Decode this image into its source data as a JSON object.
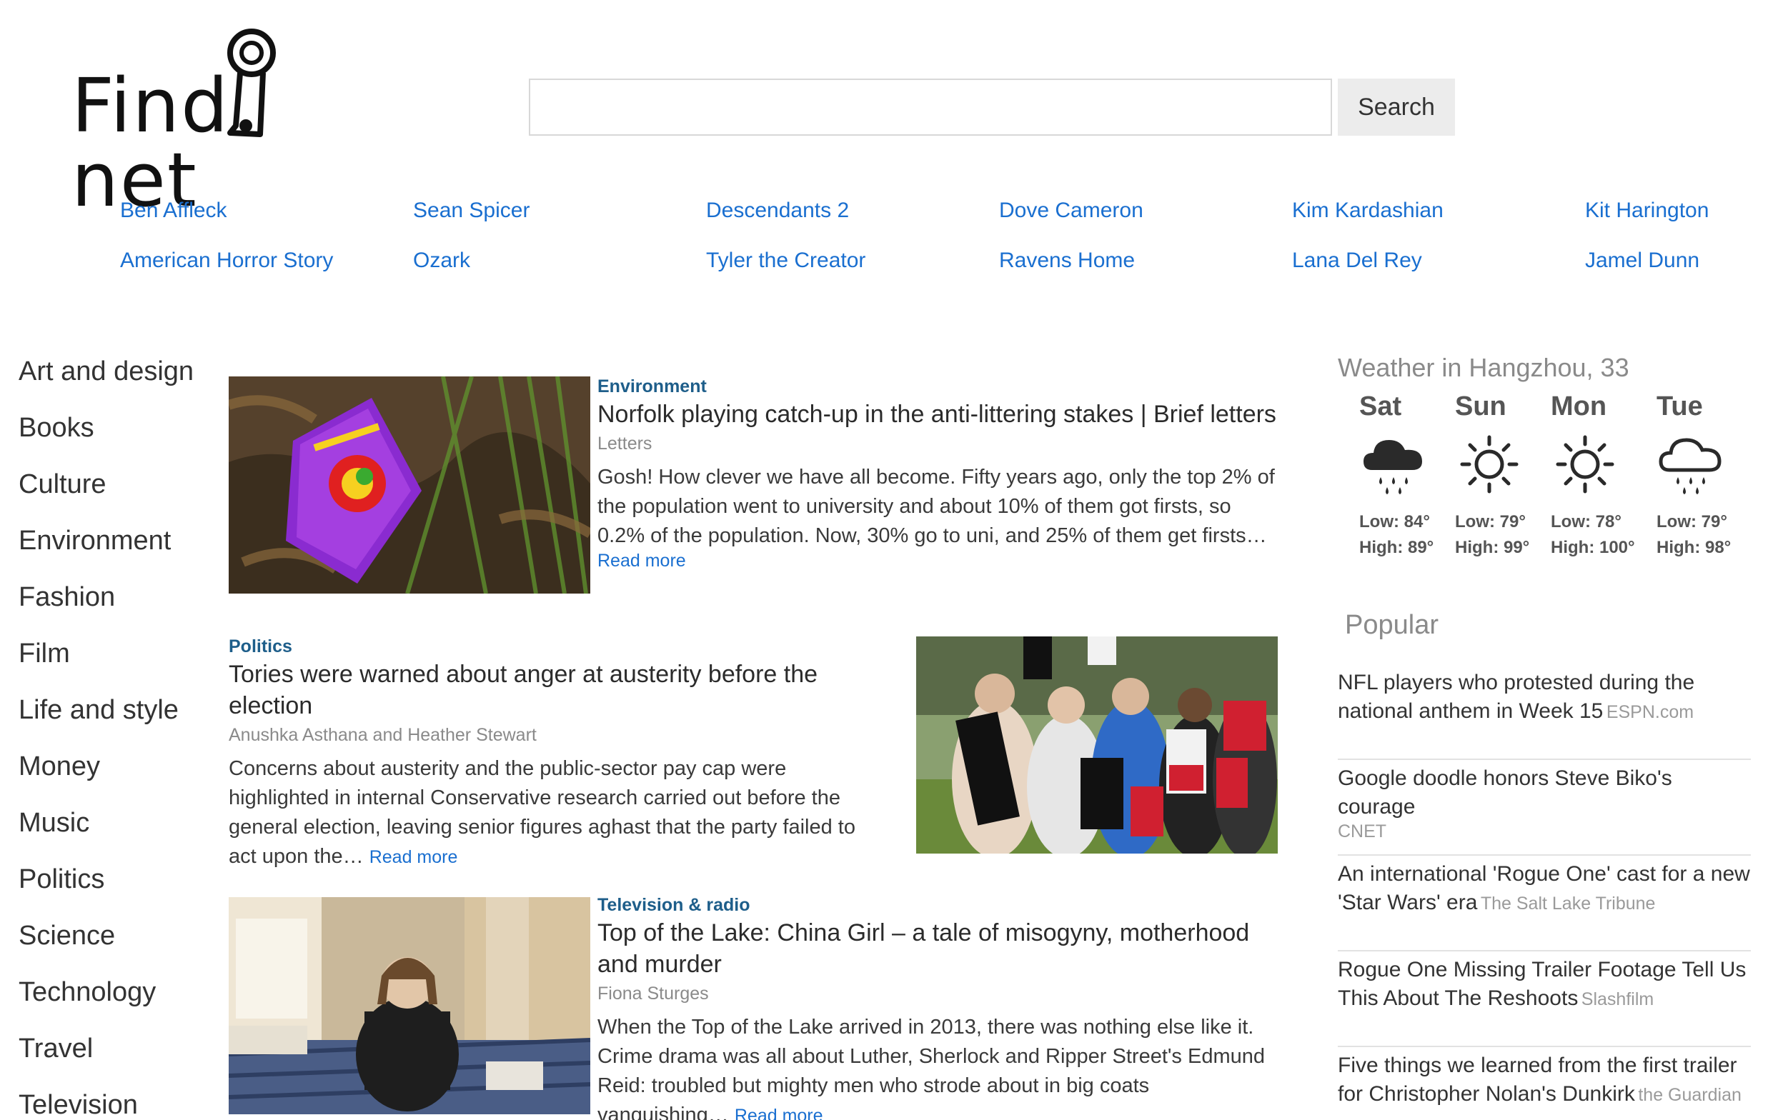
{
  "logo": {
    "text": "Find",
    "text2": "net"
  },
  "search": {
    "placeholder": "",
    "button_label": "Search"
  },
  "trends": [
    "Ben Affleck",
    "Sean Spicer",
    "Descendants 2",
    "Dove Cameron",
    "Kim Kardashian",
    "Kit Harington",
    "American Horror Story",
    "Ozark",
    "Tyler the Creator",
    "Ravens Home",
    "Lana Del Rey",
    "Jamel Dunn"
  ],
  "categories": [
    "Art and design",
    "Books",
    "Culture",
    "Environment",
    "Fashion",
    "Film",
    "Life and style",
    "Money",
    "Music",
    "Politics",
    "Science",
    "Technology",
    "Travel",
    "Television"
  ],
  "articles": [
    {
      "tag": "Environment",
      "title": "Norfolk playing catch-up in the anti-littering stakes | Brief letters",
      "author": "Letters",
      "text": "Gosh! How clever we have all become. Fifty years ago, only the top 2% of the population went to university and about 10% of them got firsts, so 0.2% of the population. Now, 30% go to uni, and 25% of them get firsts…",
      "read_more": "Read more"
    },
    {
      "tag": "Politics",
      "title": "Tories were warned about anger at austerity before the election",
      "author": "Anushka Asthana and Heather Stewart",
      "text": "Concerns about austerity and the public-sector pay cap were highlighted in internal Conservative research carried out before the general election, leaving senior figures aghast that the party failed to act upon the…",
      "read_more": "Read more"
    },
    {
      "tag": "Television & radio",
      "title": "Top of the Lake: China Girl – a tale of misogyny, motherhood and murder",
      "author": "Fiona Sturges",
      "text": "When the Top of the Lake arrived in 2013, there was nothing else like it. Crime drama was all about Luther, Sherlock and Ripper Street's Edmund Reid: troubled but mighty men who strode about in big coats vanquishing…",
      "read_more": "Read more"
    }
  ],
  "weather": {
    "title": "Weather in Hangzhou, 33",
    "days": [
      {
        "name": "Sat",
        "icon": "rain-cloud-icon",
        "low": "Low: 84°",
        "high": "High: 89°"
      },
      {
        "name": "Sun",
        "icon": "sun-icon",
        "low": "Low: 79°",
        "high": "High: 99°"
      },
      {
        "name": "Mon",
        "icon": "sun-icon",
        "low": "Low: 78°",
        "high": "High: 100°"
      },
      {
        "name": "Tue",
        "icon": "rain-cloud-outline-icon",
        "low": "Low: 79°",
        "high": "High: 98°"
      }
    ]
  },
  "popular": {
    "title": "Popular",
    "items": [
      {
        "text": "NFL players who protested during the national anthem in Week 15",
        "source": "ESPN.com"
      },
      {
        "text": "Google doodle honors Steve Biko's courage",
        "source": "CNET"
      },
      {
        "text": "An international 'Rogue One' cast for a new 'Star Wars' era",
        "source": "The Salt Lake Tribune"
      },
      {
        "text": "Rogue One Missing Trailer Footage Tell Us This About The Reshoots",
        "source": "Slashfilm"
      },
      {
        "text": "Five things we learned from the first trailer for Christopher Nolan's Dunkirk",
        "source": "the Guardian"
      }
    ]
  }
}
